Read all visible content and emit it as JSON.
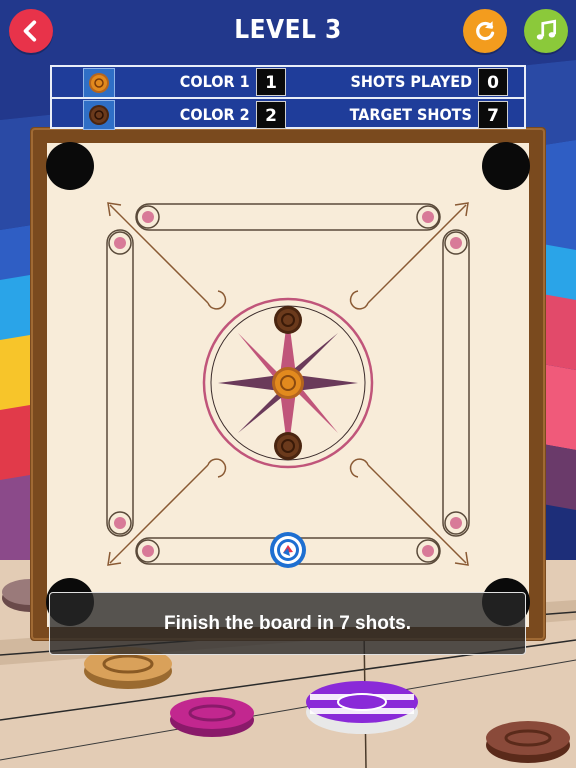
{
  "header": {
    "level_title": "LEVEL 3",
    "back_icon": "chevron-left-icon",
    "restart_icon": "restart-icon",
    "music_icon": "music-note-icon"
  },
  "stats": {
    "color1_label": "COLOR 1",
    "color1_value": "1",
    "color2_label": "COLOR 2",
    "color2_value": "2",
    "shots_played_label": "SHOTS PLAYED",
    "shots_played_value": "0",
    "target_shots_label": "TARGET SHOTS",
    "target_shots_value": "7"
  },
  "message": {
    "text": "Finish the board in 7 shots."
  },
  "colors": {
    "board_surface": "#f8ecd9",
    "board_frame": "#7a4a1e",
    "pocket": "#0a0a0a",
    "circle_accent": "#c0557a",
    "color1_coin": "#e28a1e",
    "color2_coin": "#6b3a1c",
    "striker": "#1e6fd1",
    "header_blue": "#1f3d9a"
  }
}
